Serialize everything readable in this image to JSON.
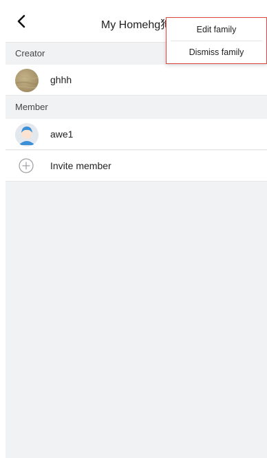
{
  "header": {
    "title": "My Homehg狗"
  },
  "sections": {
    "creator_label": "Creator",
    "member_label": "Member"
  },
  "creator": {
    "name": "ghhh"
  },
  "members": [
    {
      "name": "awe1"
    }
  ],
  "invite": {
    "label": "Invite member"
  },
  "menu": {
    "items": [
      {
        "label": "Edit family"
      },
      {
        "label": "Dismiss family"
      }
    ]
  },
  "colors": {
    "page_background": "#f1f2f4",
    "highlight_border": "#e2463f",
    "member_avatar_accent": "#3a8fd6"
  }
}
